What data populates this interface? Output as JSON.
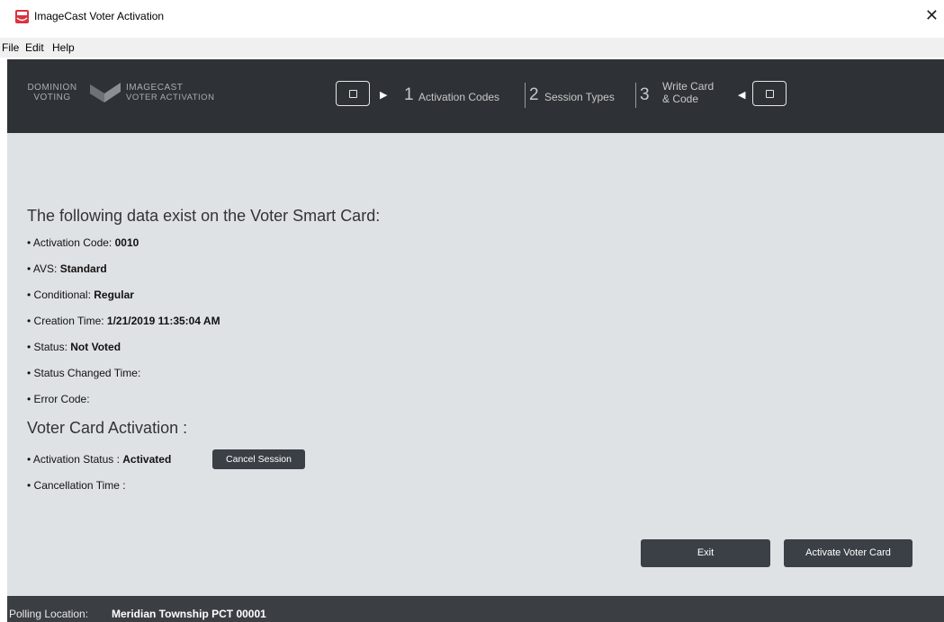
{
  "window": {
    "title": "ImageCast Voter Activation",
    "close_glyph": "✕"
  },
  "menu": {
    "items": [
      "File",
      "Edit",
      "Help"
    ]
  },
  "logo": {
    "line1a": "DOMINION",
    "line1b": "VOTING",
    "line2a": "IMAGECAST",
    "line2b": "VOTER ACTIVATION"
  },
  "steps": [
    {
      "num": "1",
      "label": "Activation Codes"
    },
    {
      "num": "2",
      "label": "Session Types"
    },
    {
      "num": "3",
      "label": "Write Card & Code"
    }
  ],
  "card_data": {
    "heading": "The following data exist on the Voter Smart Card:",
    "fields": [
      {
        "label": "Activation Code:",
        "value": "0010"
      },
      {
        "label": "AVS:",
        "value": "Standard"
      },
      {
        "label": "Conditional:",
        "value": "Regular"
      },
      {
        "label": "Creation Time:",
        "value": "1/21/2019 11:35:04 AM"
      },
      {
        "label": "Status:",
        "value": "Not Voted"
      },
      {
        "label": "Status Changed Time:",
        "value": ""
      },
      {
        "label": "Error Code:",
        "value": ""
      }
    ]
  },
  "activation": {
    "heading": "Voter Card Activation :",
    "status_label": "Activation Status :",
    "status_value": "Activated",
    "cancel_button": "Cancel Session",
    "cancellation_label": "Cancellation Time :"
  },
  "buttons": {
    "exit": "Exit",
    "activate": "Activate Voter Card"
  },
  "statusbar": {
    "label": "Polling Location:",
    "value": "Meridian Township PCT 00001"
  },
  "colors": {
    "banner": "#2e3236",
    "content_bg": "#dfe2e5",
    "button": "#3b4046",
    "statusbar": "#3b3f44"
  }
}
